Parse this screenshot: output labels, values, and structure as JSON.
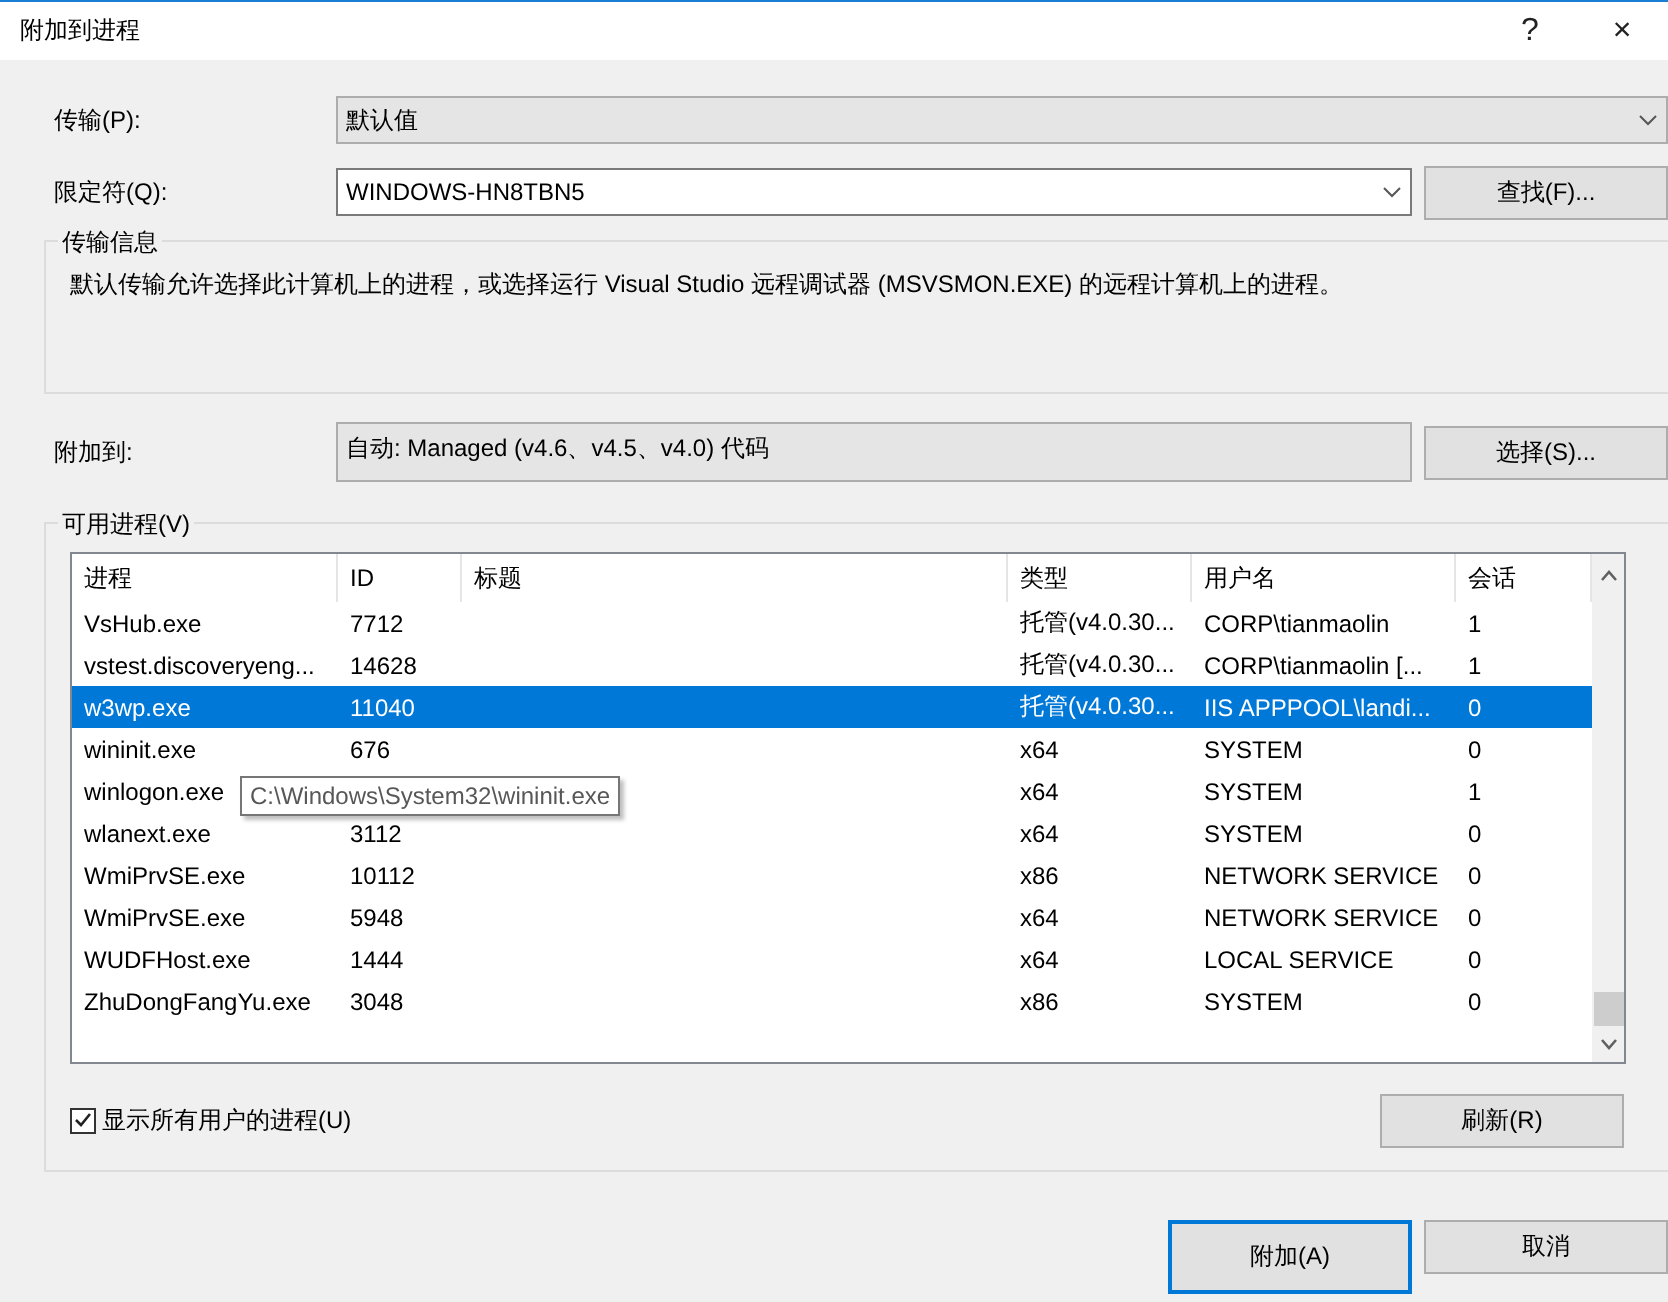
{
  "window": {
    "title": "附加到进程",
    "help": "?",
    "close": "×"
  },
  "transport": {
    "label": "传输(P):",
    "value": "默认值"
  },
  "qualifier": {
    "label": "限定符(Q):",
    "value": "WINDOWS-HN8TBN5",
    "button": "查找(F)..."
  },
  "transport_info": {
    "title": "传输信息",
    "text": "默认传输允许选择此计算机上的进程，或选择运行 Visual Studio 远程调试器 (MSVSMON.EXE) 的远程计算机上的进程。"
  },
  "attach_to": {
    "label": "附加到:",
    "value": "自动: Managed (v4.6、v4.5、v4.0) 代码",
    "button": "选择(S)..."
  },
  "processes": {
    "title": "可用进程(V)",
    "columns": [
      "进程",
      "ID",
      "标题",
      "类型",
      "用户名",
      "会话"
    ],
    "rows": [
      {
        "cells": [
          "VsHub.exe",
          "7712",
          "",
          "托管(v4.0.30...",
          "CORP\\tianmaolin",
          "1"
        ],
        "selected": false
      },
      {
        "cells": [
          "vstest.discoveryeng...",
          "14628",
          "",
          "托管(v4.0.30...",
          "CORP\\tianmaolin [...",
          "1"
        ],
        "selected": false
      },
      {
        "cells": [
          "w3wp.exe",
          "11040",
          "",
          "托管(v4.0.30...",
          "IIS APPPOOL\\landi...",
          "0"
        ],
        "selected": true
      },
      {
        "cells": [
          "wininit.exe",
          "676",
          "",
          "x64",
          "SYSTEM",
          "0"
        ],
        "selected": false
      },
      {
        "cells": [
          "winlogon.exe",
          "",
          "",
          "x64",
          "SYSTEM",
          "1"
        ],
        "selected": false
      },
      {
        "cells": [
          "wlanext.exe",
          "3112",
          "",
          "x64",
          "SYSTEM",
          "0"
        ],
        "selected": false
      },
      {
        "cells": [
          "WmiPrvSE.exe",
          "10112",
          "",
          "x86",
          "NETWORK SERVICE",
          "0"
        ],
        "selected": false
      },
      {
        "cells": [
          "WmiPrvSE.exe",
          "5948",
          "",
          "x64",
          "NETWORK SERVICE",
          "0"
        ],
        "selected": false
      },
      {
        "cells": [
          "WUDFHost.exe",
          "1444",
          "",
          "x64",
          "LOCAL SERVICE",
          "0"
        ],
        "selected": false
      },
      {
        "cells": [
          "ZhuDongFangYu.exe",
          "3048",
          "",
          "x86",
          "SYSTEM",
          "0"
        ],
        "selected": false
      }
    ],
    "tooltip": "C:\\Windows\\System32\\wininit.exe",
    "show_all_users": {
      "label": "显示所有用户的进程(U)",
      "checked": true
    },
    "refresh": "刷新(R)"
  },
  "buttons": [
    {
      "label": "附加(A)",
      "default": true
    },
    {
      "label": "取消",
      "default": false
    }
  ]
}
